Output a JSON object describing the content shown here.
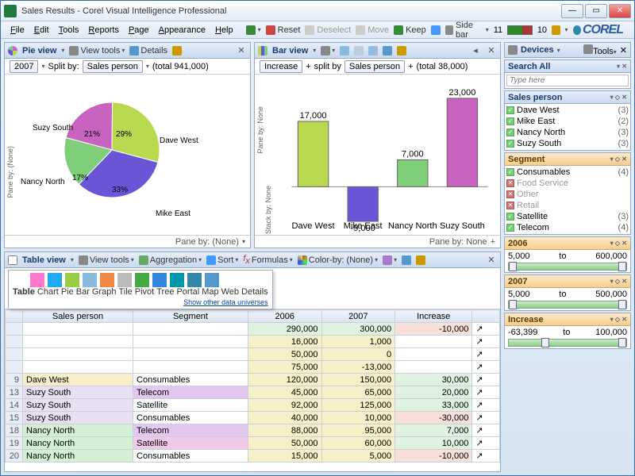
{
  "window": {
    "title": "Sales Results - Corel Visual Intelligence Professional"
  },
  "menu": [
    "File",
    "Edit",
    "Tools",
    "Reports",
    "Page",
    "Appearance",
    "Help"
  ],
  "toolbar": {
    "reset": "Reset",
    "deselect": "Deselect",
    "move": "Move",
    "keep": "Keep",
    "sidebar": "Side bar",
    "sidebar_val": "11",
    "count2": "10",
    "brand": "COREL"
  },
  "pie_panel": {
    "title": "Pie view",
    "viewtools": "View tools",
    "details": "Details",
    "year": "2007",
    "split_lbl": "Split by:",
    "split_val": "Sales person",
    "total": "(total 941,000)",
    "pane_left": "Pane by: (None)",
    "pane_bottom": "Pane by: (None)"
  },
  "chart_data": [
    {
      "type": "pie",
      "title": "Pie view",
      "categories": [
        "Dave West",
        "Mike East",
        "Nancy North",
        "Suzy South"
      ],
      "values": [
        29,
        33,
        17,
        21
      ],
      "value_labels": [
        "29%",
        "33%",
        "17%",
        "21%"
      ],
      "colors": [
        "#b7d84f",
        "#6a55d6",
        "#7fcf7a",
        "#c963c0"
      ],
      "total": 941000
    },
    {
      "type": "bar",
      "title": "Bar view — Increase split by Sales person",
      "categories": [
        "Dave West",
        "Mike East",
        "Nancy North",
        "Suzy South"
      ],
      "values": [
        17000,
        -9000,
        7000,
        23000
      ],
      "colors": [
        "#b7d84f",
        "#6a55d6",
        "#7fcf7a",
        "#c963c0"
      ],
      "total": 38000,
      "ylim": [
        -10000,
        25000
      ]
    }
  ],
  "bar_panel": {
    "title": "Bar view",
    "increase": "Increase",
    "split_lbl": "split by",
    "split_val": "Sales person",
    "total": "(total 38,000)",
    "pane_left1": "Pane by: None",
    "pane_left2": "Stack by: None",
    "pane_bottom": "Pane by: None"
  },
  "table_panel": {
    "title": "Table view",
    "viewtools": "View tools",
    "aggregation": "Aggregation",
    "sort": "Sort",
    "formulas": "Formulas",
    "colorby": "Color-by: (None)",
    "universe_labels": [
      "Table",
      "Chart",
      "Pie",
      "Bar",
      "Graph",
      "Tile",
      "Pivot",
      "Tree",
      "Portal",
      "Map",
      "Web",
      "Details"
    ],
    "universe_link": "Show other data universes",
    "columns": [
      "",
      "Sales person",
      "Segment",
      "2006",
      "2007",
      "Increase",
      ""
    ],
    "rows": [
      {
        "n": "",
        "sp": "",
        "seg": "",
        "c06": "290,000",
        "c07": "300,000",
        "inc": "-10,000",
        "clr": [
          "#fff",
          "#fff",
          "#dff2df",
          "#f8e0d8"
        ]
      },
      {
        "n": "",
        "sp": "",
        "seg": "",
        "c06": "16,000",
        "c07": "1,000",
        "inc": "",
        "clr": [
          "#fff",
          "#fff",
          "#f6efc8",
          "#fff"
        ]
      },
      {
        "n": "",
        "sp": "",
        "seg": "",
        "c06": "50,000",
        "c07": "0",
        "inc": "",
        "clr": [
          "#fff",
          "#fff",
          "#f6efc8",
          "#fff"
        ]
      },
      {
        "n": "",
        "sp": "",
        "seg": "",
        "c06": "75,000",
        "c07": "-13,000",
        "inc": "",
        "clr": [
          "#fff",
          "#fff",
          "#f6efc8",
          "#fff"
        ]
      },
      {
        "n": "9",
        "sp": "Dave West",
        "seg": "Consumables",
        "c06": "120,000",
        "c07": "150,000",
        "inc": "30,000",
        "clr": [
          "#f6efc8",
          "#fff",
          "#f6efc8",
          "#dff2df"
        ]
      },
      {
        "n": "13",
        "sp": "Suzy South",
        "seg": "Telecom",
        "c06": "45,000",
        "c07": "65,000",
        "inc": "20,000",
        "clr": [
          "#e9dff2",
          "#e2c8ef",
          "#f6efc8",
          "#dff2df"
        ]
      },
      {
        "n": "14",
        "sp": "Suzy South",
        "seg": "Satellite",
        "c06": "92,000",
        "c07": "125,000",
        "inc": "33,000",
        "clr": [
          "#e9dff2",
          "#fff",
          "#f6efc8",
          "#dff2df"
        ]
      },
      {
        "n": "15",
        "sp": "Suzy South",
        "seg": "Consumables",
        "c06": "40,000",
        "c07": "10,000",
        "inc": "-30,000",
        "clr": [
          "#e9dff2",
          "#fff",
          "#f6efc8",
          "#f8e0d8"
        ]
      },
      {
        "n": "18",
        "sp": "Nancy North",
        "seg": "Telecom",
        "c06": "88,000",
        "c07": "95,000",
        "inc": "7,000",
        "clr": [
          "#d3f0d3",
          "#e2c8ef",
          "#f6efc8",
          "#dff2df"
        ]
      },
      {
        "n": "19",
        "sp": "Nancy North",
        "seg": "Satellite",
        "c06": "50,000",
        "c07": "60,000",
        "inc": "10,000",
        "clr": [
          "#d3f0d3",
          "#f0c8e8",
          "#f6efc8",
          "#dff2df"
        ]
      },
      {
        "n": "20",
        "sp": "Nancy North",
        "seg": "Consumables",
        "c06": "15,000",
        "c07": "5,000",
        "inc": "-10,000",
        "clr": [
          "#d3f0d3",
          "#fff",
          "#f6efc8",
          "#f8e0d8"
        ]
      }
    ]
  },
  "devices": {
    "title": "Devices",
    "tools": "Tools",
    "search": {
      "title": "Search All",
      "placeholder": "Type here"
    },
    "sales_person": {
      "title": "Sales person",
      "items": [
        {
          "name": "Dave West",
          "count": "(3)",
          "on": true
        },
        {
          "name": "Mike East",
          "count": "(2)",
          "on": true
        },
        {
          "name": "Nancy North",
          "count": "(3)",
          "on": true
        },
        {
          "name": "Suzy South",
          "count": "(3)",
          "on": true
        }
      ]
    },
    "segment": {
      "title": "Segment",
      "items": [
        {
          "name": "Consumables",
          "count": "(4)",
          "on": true
        },
        {
          "name": "Food Service",
          "count": "",
          "on": false
        },
        {
          "name": "Other",
          "count": "",
          "on": false
        },
        {
          "name": "Retail",
          "count": "",
          "on": false
        },
        {
          "name": "Satellite",
          "count": "(3)",
          "on": true
        },
        {
          "name": "Telecom",
          "count": "(4)",
          "on": true
        }
      ]
    },
    "range_2006": {
      "title": "2006",
      "min": "5,000",
      "to": "to",
      "max": "600,000"
    },
    "range_2007": {
      "title": "2007",
      "min": "5,000",
      "to": "to",
      "max": "500,000"
    },
    "range_inc": {
      "title": "Increase",
      "min": "-63,399",
      "to": "to",
      "max": "100,000"
    }
  }
}
